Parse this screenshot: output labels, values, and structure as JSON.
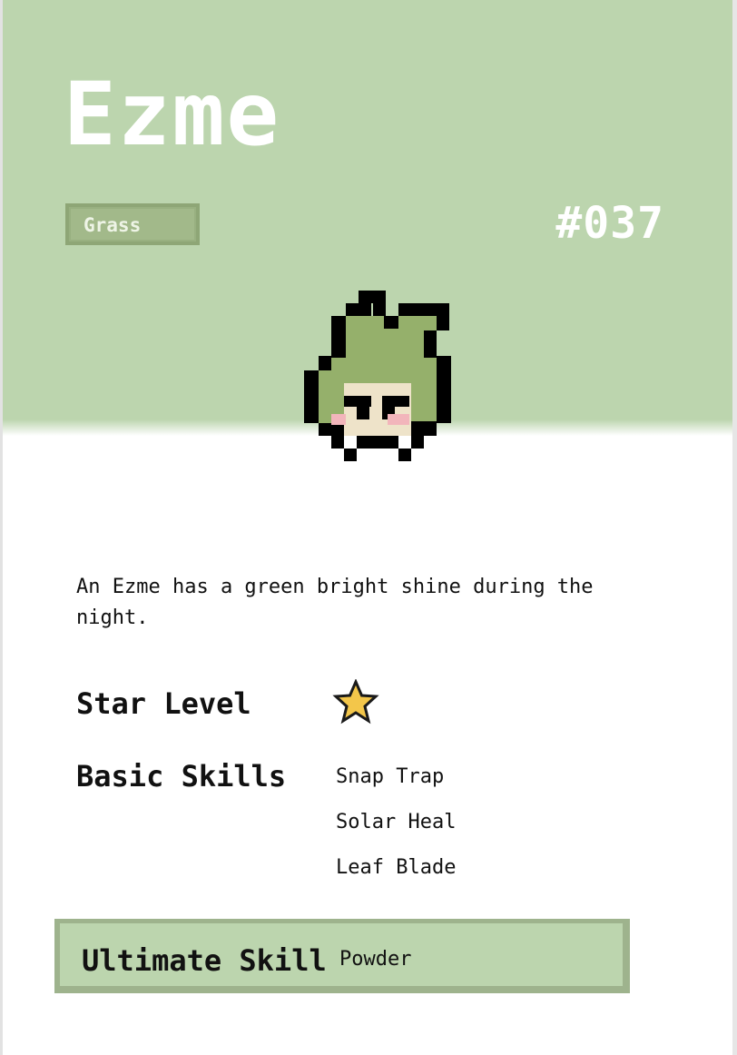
{
  "card": {
    "name": "Ezme",
    "type": "Grass",
    "number": "#037",
    "description": "An Ezme has a green bright shine during the night.",
    "star_level_label": "Star Level",
    "star_level": 1,
    "basic_skills_label": "Basic Skills",
    "basic_skills": [
      "Snap Trap",
      "Solar Heal",
      "Leaf Blade"
    ],
    "ultimate_skill_label": "Ultimate Skill",
    "ultimate_skill": "Powder"
  },
  "icons": {
    "sprite": "ezme-sprite-icon",
    "star": "star-icon"
  },
  "colors": {
    "header_bg": "#bcd5ae",
    "badge": "#a2b98a",
    "sprite_green": "#95b06b",
    "sprite_face": "#eee3c9",
    "blush": "#f2b5bb",
    "star": "#f3c64a"
  }
}
